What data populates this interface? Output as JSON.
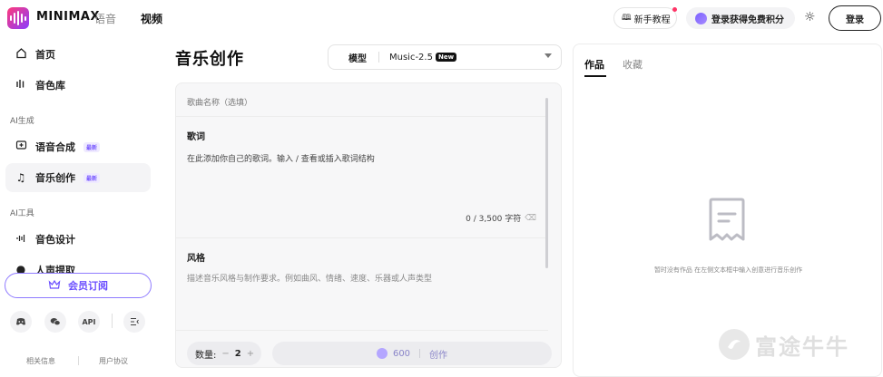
{
  "header": {
    "brand": "MINIMAX",
    "nav_voice": "语音",
    "nav_video": "视频",
    "tutorial_label": "新手教程",
    "credits_label": "登录获得免费积分",
    "login_label": "登录"
  },
  "sidebar": {
    "items": [
      {
        "label": "首页",
        "icon": "home-icon"
      },
      {
        "label": "音色库",
        "icon": "voice-library-icon"
      },
      {
        "label": "语音合成",
        "icon": "speech-synthesis-icon",
        "badge": "最新"
      },
      {
        "label": "音乐创作",
        "icon": "music-note-icon",
        "badge": "最新"
      },
      {
        "label": "音色设计",
        "icon": "voice-design-icon"
      },
      {
        "label": "人声提取",
        "icon": "vocal-extract-icon"
      }
    ],
    "section_ai_generate": "AI生成",
    "section_ai_tools": "AI工具",
    "member_label": "会员订阅",
    "social_api": "API",
    "footer": {
      "related": "相关信息",
      "agreement": "用户协议"
    }
  },
  "main": {
    "title": "音乐创作",
    "model_label": "模型",
    "model_value": "Music-2.5",
    "model_tag": "New",
    "song_name_placeholder": "歌曲名称（选填）",
    "lyrics_label": "歌词",
    "lyrics_placeholder": "在此添加你自己的歌词。输入 / 查看或插入歌词结构",
    "lyrics_counter": "0 / 3,500 字符",
    "style_label": "风格",
    "style_placeholder": "描述音乐风格与制作要求。例如曲风、情绪、速度、乐器或人声类型",
    "quantity_label": "数量:",
    "quantity_minus": "−",
    "quantity_value": "2",
    "quantity_plus": "+",
    "create_credits": "600",
    "create_label": "创作"
  },
  "works": {
    "tab_works": "作品",
    "tab_favorites": "收藏",
    "empty_text": "暂时没有作品 在左侧文本框中输入创意进行音乐创作"
  },
  "watermark": "富途牛牛",
  "colors": {
    "accent": "#7b5cff",
    "accent_light": "#b4a6ff",
    "brand_gradient_start": "#ff3a7a",
    "brand_gradient_end": "#8a3cff",
    "notification_dot": "#ff3366"
  }
}
